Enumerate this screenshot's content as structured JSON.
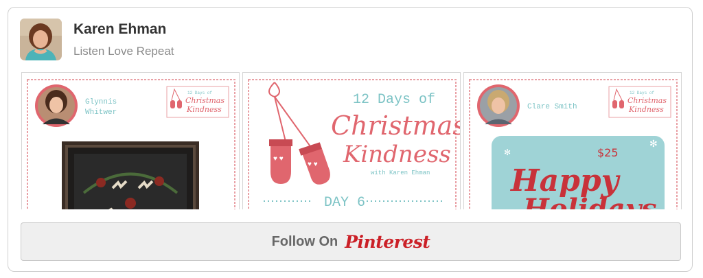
{
  "profile": {
    "name": "Karen Ehman",
    "board": "Listen Love Repeat"
  },
  "pins": [
    {
      "author": "Glynnis",
      "author2": "Whitwer",
      "badge": "12 Days of",
      "badge_title": "Christmas",
      "badge_title2": "Kindness"
    },
    {
      "pre_title": "12 Days of",
      "title": "Christmas",
      "title2": "Kindness",
      "byline": "with Karen Ehman",
      "day": "DAY 6"
    },
    {
      "author": "Clare Smith",
      "badge": "12 Days of",
      "badge_title": "Christmas",
      "badge_title2": "Kindness",
      "gift_amount": "$25",
      "gift_text": "Happy",
      "gift_text2": "Holidays"
    }
  ],
  "follow_button": {
    "label": "Follow On",
    "brand": "Pinterest"
  },
  "colors": {
    "accent": "#cb2027",
    "pink": "#e0666e",
    "teal": "#7cc3c5"
  }
}
